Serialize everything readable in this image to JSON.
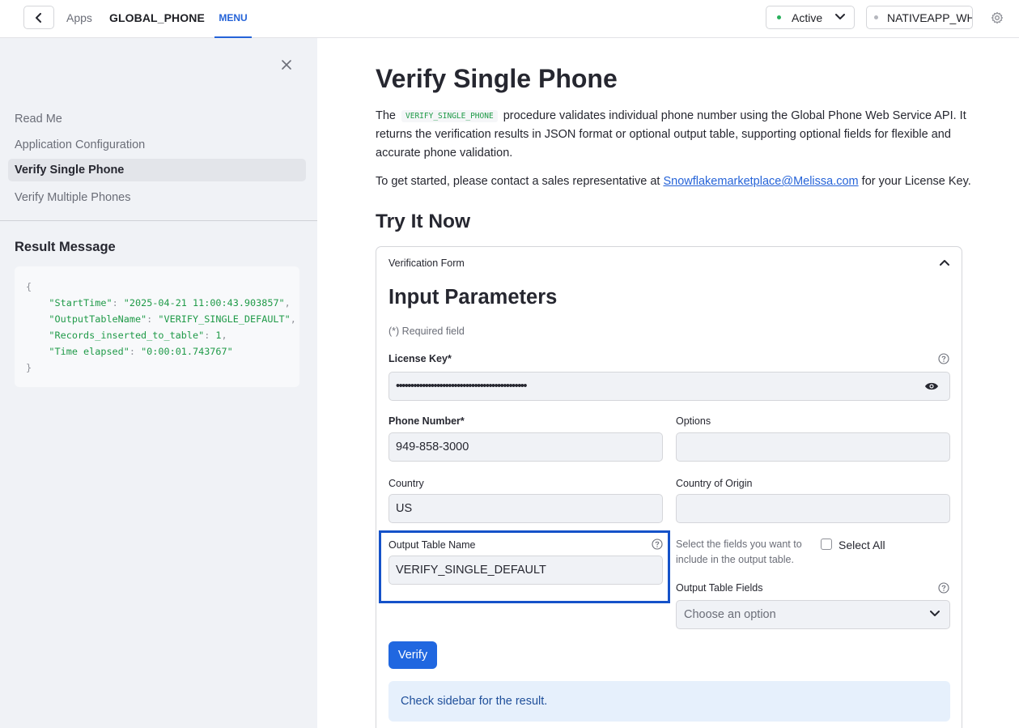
{
  "topbar": {
    "apps_label": "Apps",
    "app_name": "GLOBAL_PHONE",
    "menu_tab": "MENU",
    "status": "Active",
    "warehouse": "NATIVEAPP_WH"
  },
  "sidebar": {
    "nav": [
      {
        "label": "Read Me"
      },
      {
        "label": "Application Configuration"
      },
      {
        "label": "Verify Single Phone"
      },
      {
        "label": "Verify Multiple Phones"
      }
    ],
    "result_title": "Result Message",
    "result": {
      "open": "{",
      "lines": [
        {
          "key": "\"StartTime\"",
          "value": "\"2025-04-21 11:00:43.903857\"",
          "comma": ","
        },
        {
          "key": "\"OutputTableName\"",
          "value": "\"VERIFY_SINGLE_DEFAULT\"",
          "comma": ","
        },
        {
          "key": "\"Records_inserted_to_table\"",
          "value": "1",
          "comma": ","
        },
        {
          "key": "\"Time elapsed\"",
          "value": "\"0:00:01.743767\"",
          "comma": ""
        }
      ],
      "close": "}"
    }
  },
  "main": {
    "title": "Verify Single Phone",
    "intro_prefix": "The",
    "intro_code": "VERIFY_SINGLE_PHONE",
    "intro_rest": "procedure validates individual phone number using the Global Phone Web Service API. It returns the verification results in JSON format or optional output table, supporting optional fields for flexible and accurate phone validation.",
    "contact_prefix": "To get started, please contact a sales representative at",
    "contact_email": "Snowflakemarketplace@Melissa.com",
    "contact_suffix": "for your License Key.",
    "try_title": "Try It Now"
  },
  "form": {
    "header": "Verification Form",
    "title": "Input Parameters",
    "required_note": "(*) Required field",
    "license_label": "License Key*",
    "license_value": "•••••••••••••••••••••••••••••••••••••••••••••",
    "phone_label": "Phone Number*",
    "phone_value": "949-858-3000",
    "options_label": "Options",
    "options_value": "",
    "country_label": "Country",
    "country_value": "US",
    "origin_label": "Country of Origin",
    "origin_value": "",
    "output_table_label": "Output Table Name",
    "output_table_value": "VERIFY_SINGLE_DEFAULT",
    "fields_hint": "Select the fields you want to include in the output table.",
    "select_all_label": "Select All",
    "output_fields_label": "Output Table Fields",
    "output_fields_placeholder": "Choose an option",
    "verify_label": "Verify",
    "info_message": "Check sidebar for the result."
  },
  "colors": {
    "accent": "#2563d8",
    "highlight": "#1552c9",
    "button": "#2067e0",
    "code_green": "#1f9a48"
  }
}
